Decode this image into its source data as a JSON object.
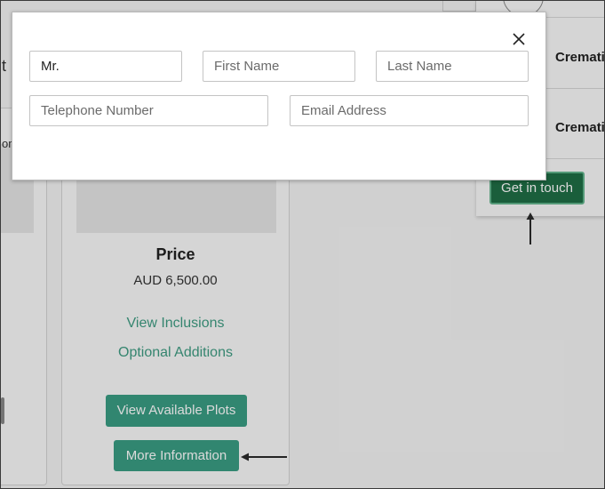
{
  "background": {
    "left_card": {
      "text_fragment_top": "t",
      "text_fragment_mid": "or"
    },
    "product_card": {
      "price_title": "Price",
      "price_value": "AUD 6,500.00",
      "view_inclusions_label": "View Inclusions",
      "optional_additions_label": "Optional Additions",
      "view_plots_label": "View Available Plots",
      "more_info_label": "More Information"
    },
    "right_panel": {
      "row1_label": "Crematio",
      "row2_label": "Crematio",
      "get_in_touch_label": "Get in touch"
    },
    "colors": {
      "accent_teal": "#3a9d84",
      "dark_green": "#1f6e45",
      "link_green": "#3e9c82"
    }
  },
  "modal": {
    "close_icon": "close-icon",
    "fields": {
      "title_value": "Mr.",
      "first_name_placeholder": "First Name",
      "last_name_placeholder": "Last Name",
      "telephone_placeholder": "Telephone Number",
      "email_placeholder": "Email Address"
    }
  },
  "annotations": {
    "arrow_up_icon": "arrow-up-icon",
    "arrow_left_icon": "arrow-left-icon"
  }
}
